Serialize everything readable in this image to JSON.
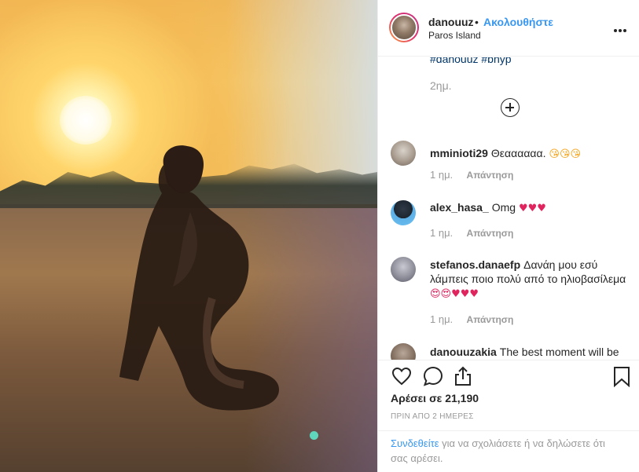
{
  "header": {
    "username": "danouuz",
    "dot": "•",
    "follow_label": "Ακολουθήστε",
    "location": "Paros Island"
  },
  "caption": {
    "hashtags": "#danouuz #bnyp",
    "time": "2ημ."
  },
  "comments": [
    {
      "user": "mminioti29",
      "text": "Θεαααααα.",
      "emoji": "😘😘😘",
      "time": "1 ημ.",
      "reply": "Απάντηση"
    },
    {
      "user": "alex_hasa_",
      "text": "Omg",
      "emoji": "♥♥♥",
      "time": "1 ημ.",
      "reply": "Απάντηση"
    },
    {
      "user": "stefanos.danaefp",
      "text": "Δανάη μου εσύ λάμπεις ποιο πολύ από το ηλιοβασίλεμα",
      "emoji": "😍😍♥♥♥",
      "time": "1 ημ.",
      "reply": "Απάντηση"
    },
    {
      "user": "danouuzakia",
      "text": "The best moment will be"
    }
  ],
  "footer": {
    "likes": "Αρέσει σε 21,190",
    "post_time": "ΠΡΙΝ ΑΠΟ 2 ΗΜΕΡΕΣ",
    "login_link": "Συνδεθείτε",
    "login_rest": " για να σχολιάσετε ή να δηλώσετε ότι σας αρέσει."
  },
  "colors": {
    "accent": "#3897f0",
    "text": "#262626",
    "muted": "#999999",
    "heart": "#e0245e"
  },
  "icons": [
    "more-icon",
    "add-comment-icon",
    "like-icon",
    "comment-icon",
    "share-icon",
    "save-icon"
  ]
}
